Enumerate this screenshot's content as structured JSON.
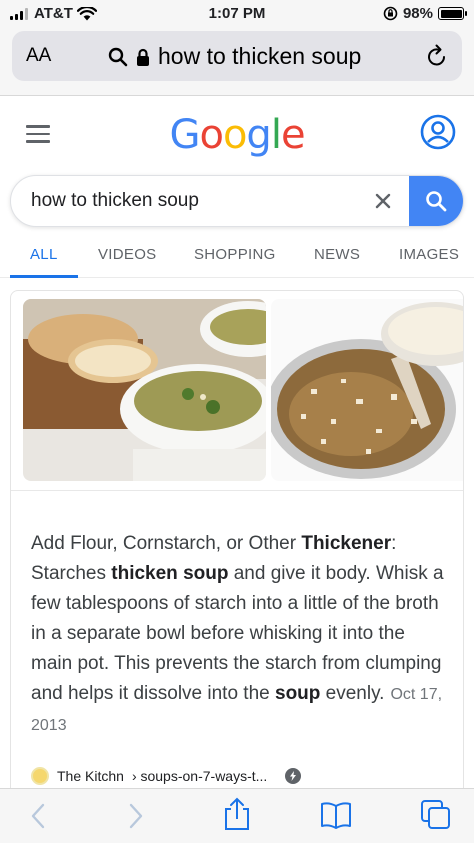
{
  "status_bar": {
    "carrier": "AT&T",
    "time": "1:07 PM",
    "battery": "98%"
  },
  "browser": {
    "text_size_label": "AA",
    "url_text": "how to thicken soup"
  },
  "google": {
    "logo_letters": [
      "G",
      "o",
      "o",
      "g",
      "l",
      "e"
    ],
    "logo_colors": [
      "#4285f4",
      "#ea4335",
      "#fbbc05",
      "#4285f4",
      "#34a853",
      "#ea4335"
    ]
  },
  "search": {
    "query": "how to thicken soup"
  },
  "tabs": [
    {
      "label": "ALL",
      "active": true
    },
    {
      "label": "VIDEOS",
      "active": false
    },
    {
      "label": "SHOPPING",
      "active": false
    },
    {
      "label": "NEWS",
      "active": false
    },
    {
      "label": "IMAGES",
      "active": false
    }
  ],
  "result": {
    "snippet_parts": [
      {
        "text": "Add Flour, Cornstarch, or Other ",
        "bold": false
      },
      {
        "text": "Thickener",
        "bold": true
      },
      {
        "text": ": Starches ",
        "bold": false
      },
      {
        "text": "thicken soup",
        "bold": true
      },
      {
        "text": " and give it body. Whisk a few tablespoons of starch into a little of the broth in a separate bowl before whisking it into the main pot. This prevents the starch from clumping and helps it dissolve into the ",
        "bold": false
      },
      {
        "text": "soup",
        "bold": true
      },
      {
        "text": " evenly.",
        "bold": false
      }
    ],
    "date": "Oct 17, 2013",
    "source_name": "The Kitchn",
    "source_path": "› soups-on-7-ways-t..."
  },
  "colors": {
    "accent": "#1a73e8",
    "search_button": "#4285f4"
  },
  "icons": [
    "wifi-icon",
    "signal-icon",
    "lock-icon",
    "search-icon",
    "reload-icon",
    "menu-icon",
    "account-icon",
    "clear-icon",
    "amp-icon",
    "back-icon",
    "forward-icon",
    "share-icon",
    "bookmarks-icon",
    "tabs-icon"
  ]
}
